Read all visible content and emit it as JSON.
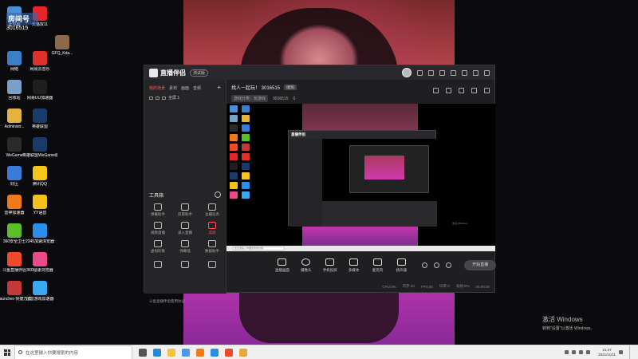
{
  "desktop": {
    "room_overlay": {
      "title": "房间号",
      "number": "3016515"
    },
    "icons_left": [
      {
        "label": "此电脑",
        "color": "#4a8fd8"
      },
      {
        "label": "网络",
        "color": "#3b7fc8"
      },
      {
        "label": "回收站",
        "color": "#7aa0c8"
      },
      {
        "label": "Administr...",
        "color": "#e3b341"
      },
      {
        "label": "WeGame",
        "color": "#2a2a2a"
      },
      {
        "label": "好压",
        "color": "#3a7ad8"
      },
      {
        "label": "雷神加速器",
        "color": "#f07a1a"
      },
      {
        "label": "360安全卫士",
        "color": "#5bbf2a"
      },
      {
        "label": "斗鱼直播伴侣",
        "color": "#f04a2a"
      },
      {
        "label": "Launcher-快捷方式",
        "color": "#c23a3a"
      }
    ],
    "icons_right": [
      {
        "label": "天猫双11",
        "color": "#e8242a"
      },
      {
        "label": "网易云音乐",
        "color": "#e0302a"
      },
      {
        "label": "网易UU加速器",
        "color": "#1f1f1f"
      },
      {
        "label": "英雄联盟",
        "color": "#1a3a6a"
      },
      {
        "label": "英雄联盟WeGame版",
        "color": "#1a3a6a"
      },
      {
        "label": "腾讯QQ",
        "color": "#f5c518"
      },
      {
        "label": "YY语音",
        "color": "#f2c21a"
      },
      {
        "label": "2345加速浏览器",
        "color": "#2a8fe8"
      },
      {
        "label": "360极速浏览器",
        "color": "#e84a8a"
      },
      {
        "label": "迅雷游戏加速器",
        "color": "#3aa8f0"
      }
    ],
    "extra_icon": {
      "label": "GFQ_Kda...",
      "color": "#8a6a4a"
    },
    "activation": {
      "title": "激活 Windows",
      "subtitle": "转到\"设置\"以激活 Windows。"
    }
  },
  "app": {
    "name": "直播伴侣",
    "version_badge": "测试版",
    "left_tabs": [
      {
        "label": "我的场景",
        "active": true
      },
      {
        "label": "素材",
        "active": false
      },
      {
        "label": "画面",
        "active": false
      },
      {
        "label": "音频",
        "active": false
      }
    ],
    "add_tab": "+",
    "scene": "全屏 1",
    "toolbox": {
      "title": "工具箱",
      "tools": [
        {
          "label": "弹幕助手",
          "red": false
        },
        {
          "label": "房管助手",
          "red": false
        },
        {
          "label": "主播任务",
          "red": false
        },
        {
          "label": "视频直播",
          "red": false
        },
        {
          "label": "录入直播",
          "red": false
        },
        {
          "label": "美颜",
          "red": true
        },
        {
          "label": "虚拟形象",
          "red": false
        },
        {
          "label": "弹幕墙",
          "red": false
        },
        {
          "label": "数据助手",
          "red": false
        },
        {
          "label": "",
          "red": false
        },
        {
          "label": "",
          "red": false
        },
        {
          "label": "",
          "red": false
        }
      ]
    },
    "notice": "斗鱼直播伴侣使用协议",
    "room": {
      "title": "找人一起玩！ 3016515",
      "edit": "编辑"
    },
    "info": {
      "category": "游戏分类：玩游戏",
      "id": "3016515",
      "extra": "0"
    },
    "controls": [
      {
        "label": "直播画面",
        "round": false
      },
      {
        "label": "摄像头",
        "round": true
      },
      {
        "label": "手机投屏",
        "round": false
      },
      {
        "label": "多媒体",
        "round": false
      },
      {
        "label": "麦克风",
        "round": false
      },
      {
        "label": "扬声器",
        "round": false
      }
    ],
    "start_live": "开始直播",
    "status": [
      "CPU:0%",
      "内存:40",
      "FPS:30",
      "码率:0",
      "丢帧:0%",
      "00:00:00"
    ],
    "preview": {
      "nested_title": "直播伴侣",
      "mini_search": "在这里输入你要搜索的内容",
      "mini_watermark": "激活 Windows"
    }
  },
  "taskbar": {
    "search_placeholder": "在这里输入你要搜索的内容",
    "pinned": [
      {
        "name": "task-view",
        "color": "#555555"
      },
      {
        "name": "edge",
        "color": "#2a88d8"
      },
      {
        "name": "file-explorer",
        "color": "#f2c33a"
      },
      {
        "name": "store",
        "color": "#4a9ae8"
      },
      {
        "name": "game-app",
        "color": "#f07a1a"
      },
      {
        "name": "media-app",
        "color": "#2a8fe8"
      },
      {
        "name": "douyu",
        "color": "#f04a2a"
      },
      {
        "name": "folder",
        "color": "#e8a83a"
      }
    ],
    "clock": {
      "time": "21:47",
      "date": "2021/11/11"
    }
  }
}
